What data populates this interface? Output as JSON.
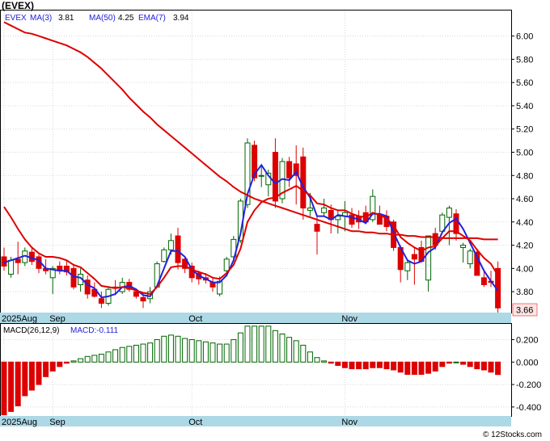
{
  "header": {
    "symbol": "(EVEX)"
  },
  "legend": {
    "ticker": "EVEX",
    "ma3_label": "MA(3)",
    "ma3_value": "3.81",
    "ma50_label": "MA(50)",
    "ma50_value": "4.25",
    "ema7_label": "EMA(7)",
    "ema7_value": "3.94"
  },
  "price_axis": {
    "ticks": [
      "6.00",
      "5.80",
      "5.60",
      "5.40",
      "5.20",
      "5.00",
      "4.80",
      "4.60",
      "4.40",
      "4.20",
      "4.00",
      "3.80"
    ]
  },
  "last_price_label": "3.66",
  "date_axis": {
    "labels": [
      "2025Aug",
      "Sep",
      "Oct",
      "Nov"
    ]
  },
  "macd_legend": {
    "label": "MACD(26,12,9)",
    "value_label": "MACD:-0.111"
  },
  "macd_axis": {
    "ticks": [
      "0.200",
      "0.000",
      "-0.200",
      "-0.400"
    ]
  },
  "watermark": "© 12Stocks.com",
  "colors": {
    "up_candle": "#006400",
    "down_candle": "#dd0000",
    "ma_fast": "#2222dd",
    "ma_slow": "#dd0000",
    "axis_bar": "#add8e6",
    "macd_pos": "#006400",
    "macd_neg": "#dd0000"
  },
  "chart_data": [
    {
      "type": "candlestick",
      "title": "(EVEX)",
      "ylim": [
        3.62,
        6.22
      ],
      "yticks": [
        6.0,
        5.8,
        5.6,
        5.4,
        5.2,
        5.0,
        4.8,
        4.6,
        4.4,
        4.2,
        4.0,
        3.8
      ],
      "x_labels": [
        {
          "label": "2025Aug",
          "index": 0
        },
        {
          "label": "Sep",
          "index": 7
        },
        {
          "label": "Oct",
          "index": 27
        },
        {
          "label": "Nov",
          "index": 49
        }
      ],
      "ohlc": [
        [
          4.1,
          4.18,
          3.98,
          4.02
        ],
        [
          3.95,
          4.1,
          3.92,
          4.07
        ],
        [
          4.08,
          4.23,
          3.95,
          4.05
        ],
        [
          4.05,
          4.18,
          4.02,
          4.15
        ],
        [
          4.14,
          4.18,
          4.03,
          4.06
        ],
        [
          4.1,
          4.12,
          3.96,
          4.0
        ],
        [
          4.0,
          4.08,
          3.95,
          3.98
        ],
        [
          3.92,
          4.02,
          3.78,
          4.0
        ],
        [
          4.02,
          4.06,
          3.95,
          3.98
        ],
        [
          4.02,
          4.07,
          3.94,
          3.97
        ],
        [
          4.0,
          4.03,
          3.82,
          3.84
        ],
        [
          3.86,
          4.0,
          3.8,
          3.95
        ],
        [
          3.9,
          3.94,
          3.74,
          3.78
        ],
        [
          3.82,
          3.88,
          3.75,
          3.76
        ],
        [
          3.74,
          3.8,
          3.66,
          3.7
        ],
        [
          3.7,
          3.84,
          3.68,
          3.82
        ],
        [
          3.84,
          3.9,
          3.77,
          3.83
        ],
        [
          3.8,
          3.92,
          3.78,
          3.88
        ],
        [
          3.88,
          3.91,
          3.8,
          3.82
        ],
        [
          3.8,
          3.82,
          3.74,
          3.76
        ],
        [
          3.75,
          3.79,
          3.66,
          3.72
        ],
        [
          3.74,
          3.84,
          3.7,
          3.8
        ],
        [
          3.84,
          4.06,
          3.84,
          4.04
        ],
        [
          4.06,
          4.18,
          4.05,
          4.16
        ],
        [
          4.16,
          4.3,
          4.12,
          4.24
        ],
        [
          4.28,
          4.35,
          3.99,
          4.05
        ],
        [
          4.08,
          4.1,
          3.96,
          4.0
        ],
        [
          4.02,
          4.05,
          3.88,
          3.92
        ],
        [
          3.96,
          3.98,
          3.86,
          3.91
        ],
        [
          3.92,
          3.96,
          3.87,
          3.9
        ],
        [
          3.88,
          3.92,
          3.8,
          3.84
        ],
        [
          3.78,
          3.93,
          3.76,
          3.89
        ],
        [
          3.98,
          4.1,
          3.95,
          4.08
        ],
        [
          4.1,
          4.28,
          4.08,
          4.25
        ],
        [
          4.24,
          4.6,
          4.22,
          4.58
        ],
        [
          4.55,
          5.12,
          4.52,
          5.08
        ],
        [
          5.06,
          5.1,
          4.75,
          4.78
        ],
        [
          4.8,
          4.88,
          4.7,
          4.8
        ],
        [
          4.72,
          4.85,
          4.62,
          4.82
        ],
        [
          5.0,
          5.12,
          4.52,
          4.58
        ],
        [
          4.6,
          4.95,
          4.56,
          4.92
        ],
        [
          4.92,
          4.96,
          4.7,
          4.78
        ],
        [
          4.9,
          5.06,
          4.55,
          4.8
        ],
        [
          4.96,
          5.04,
          4.42,
          4.52
        ],
        [
          4.5,
          4.65,
          4.45,
          4.52
        ],
        [
          4.38,
          4.45,
          4.12,
          4.32
        ],
        [
          4.48,
          4.6,
          4.45,
          4.52
        ],
        [
          4.5,
          4.55,
          4.3,
          4.42
        ],
        [
          4.42,
          4.5,
          4.3,
          4.45
        ],
        [
          4.45,
          4.58,
          4.32,
          4.48
        ],
        [
          4.46,
          4.52,
          4.35,
          4.38
        ],
        [
          4.45,
          4.5,
          4.34,
          4.4
        ],
        [
          4.48,
          4.54,
          4.38,
          4.4
        ],
        [
          4.42,
          4.68,
          4.4,
          4.62
        ],
        [
          4.46,
          4.54,
          4.4,
          4.38
        ],
        [
          4.45,
          4.5,
          4.32,
          4.36
        ],
        [
          4.4,
          4.42,
          4.15,
          4.18
        ],
        [
          4.18,
          4.2,
          3.88,
          3.99
        ],
        [
          3.98,
          4.08,
          3.9,
          4.05
        ],
        [
          4.12,
          4.18,
          3.86,
          4.08
        ],
        [
          4.18,
          4.24,
          4.05,
          4.06
        ],
        [
          3.9,
          4.28,
          3.8,
          4.28
        ],
        [
          4.3,
          4.35,
          4.16,
          4.2
        ],
        [
          4.32,
          4.48,
          4.3,
          4.46
        ],
        [
          4.44,
          4.54,
          4.2,
          4.52
        ],
        [
          4.47,
          4.51,
          4.24,
          4.3
        ],
        [
          4.18,
          4.22,
          4.05,
          4.2
        ],
        [
          4.04,
          4.17,
          4.0,
          4.15
        ],
        [
          4.14,
          4.17,
          3.94,
          3.94
        ],
        [
          3.92,
          3.98,
          3.84,
          3.86
        ],
        [
          3.89,
          3.98,
          3.84,
          3.88
        ],
        [
          4.0,
          4.06,
          3.62,
          3.66
        ]
      ],
      "series": [
        {
          "name": "MA(3)",
          "values": [
            4.05,
            4.07,
            4.09,
            4.11,
            4.09,
            4.07,
            4.0,
            3.99,
            3.98,
            3.98,
            3.93,
            3.92,
            3.86,
            3.83,
            3.75,
            3.76,
            3.78,
            3.84,
            3.85,
            3.82,
            3.77,
            3.76,
            3.85,
            4.0,
            4.15,
            4.15,
            4.1,
            3.99,
            3.94,
            3.91,
            3.88,
            3.88,
            3.94,
            4.07,
            4.3,
            4.64,
            4.81,
            4.89,
            4.8,
            4.73,
            4.77,
            4.76,
            4.83,
            4.7,
            4.61,
            4.45,
            4.45,
            4.42,
            4.46,
            4.45,
            4.44,
            4.42,
            4.39,
            4.47,
            4.47,
            4.45,
            4.31,
            4.18,
            4.07,
            4.04,
            4.06,
            4.14,
            4.18,
            4.31,
            4.39,
            4.43,
            4.34,
            4.22,
            4.1,
            3.98,
            3.89,
            3.81
          ]
        },
        {
          "name": "MA(50)",
          "values": [
            6.12,
            6.09,
            6.06,
            6.03,
            6.02,
            6.0,
            5.98,
            5.96,
            5.94,
            5.92,
            5.89,
            5.86,
            5.82,
            5.77,
            5.72,
            5.66,
            5.6,
            5.54,
            5.47,
            5.41,
            5.35,
            5.3,
            5.24,
            5.19,
            5.14,
            5.09,
            5.04,
            4.99,
            4.94,
            4.89,
            4.84,
            4.79,
            4.75,
            4.7,
            4.66,
            4.63,
            4.6,
            4.58,
            4.56,
            4.54,
            4.52,
            4.5,
            4.48,
            4.46,
            4.44,
            4.42,
            4.4,
            4.38,
            4.36,
            4.34,
            4.32,
            4.32,
            4.31,
            4.31,
            4.3,
            4.3,
            4.29,
            4.29,
            4.28,
            4.28,
            4.27,
            4.27,
            4.27,
            4.26,
            4.26,
            4.26,
            4.26,
            4.26,
            4.26,
            4.25,
            4.25,
            4.25
          ]
        },
        {
          "name": "EMA(7)",
          "values": [
            4.53,
            4.44,
            4.34,
            4.25,
            4.18,
            4.13,
            4.1,
            4.1,
            4.09,
            4.07,
            4.03,
            4.01,
            3.96,
            3.91,
            3.85,
            3.84,
            3.83,
            3.84,
            3.83,
            3.81,
            3.79,
            3.78,
            3.84,
            3.92,
            4.01,
            4.02,
            4.02,
            3.99,
            3.97,
            3.95,
            3.92,
            3.91,
            3.96,
            4.03,
            4.17,
            4.4,
            4.5,
            4.57,
            4.6,
            4.61,
            4.65,
            4.68,
            4.71,
            4.67,
            4.63,
            4.56,
            4.55,
            4.52,
            4.5,
            4.5,
            4.47,
            4.45,
            4.44,
            4.48,
            4.46,
            4.43,
            4.37,
            4.27,
            4.22,
            4.18,
            4.15,
            4.18,
            4.19,
            4.26,
            4.32,
            4.32,
            4.28,
            4.24,
            4.16,
            4.09,
            4.04,
            3.94
          ]
        }
      ]
    },
    {
      "type": "bar",
      "title": "MACD(26,12,9)",
      "ylim": [
        -0.48,
        0.34
      ],
      "yticks": [
        0.2,
        0.0,
        -0.2,
        -0.4
      ],
      "x_labels": [
        {
          "label": "2025Aug",
          "index": 0
        },
        {
          "label": "Sep",
          "index": 7
        },
        {
          "label": "Oct",
          "index": 27
        },
        {
          "label": "Nov",
          "index": 49
        }
      ],
      "values": [
        -0.47,
        -0.44,
        -0.39,
        -0.3,
        -0.25,
        -0.2,
        -0.13,
        -0.08,
        -0.04,
        -0.01,
        0.01,
        0.03,
        0.05,
        0.06,
        0.07,
        0.09,
        0.11,
        0.13,
        0.14,
        0.15,
        0.16,
        0.17,
        0.2,
        0.23,
        0.24,
        0.23,
        0.21,
        0.2,
        0.19,
        0.18,
        0.17,
        0.16,
        0.16,
        0.2,
        0.26,
        0.32,
        0.32,
        0.32,
        0.32,
        0.28,
        0.25,
        0.22,
        0.19,
        0.15,
        0.09,
        0.04,
        0.01,
        -0.01,
        -0.03,
        -0.05,
        -0.06,
        -0.06,
        -0.06,
        -0.05,
        -0.05,
        -0.06,
        -0.07,
        -0.09,
        -0.11,
        -0.11,
        -0.11,
        -0.1,
        -0.08,
        -0.04,
        -0.01,
        0.0,
        -0.02,
        -0.04,
        -0.06,
        -0.07,
        -0.09,
        -0.111
      ]
    }
  ]
}
